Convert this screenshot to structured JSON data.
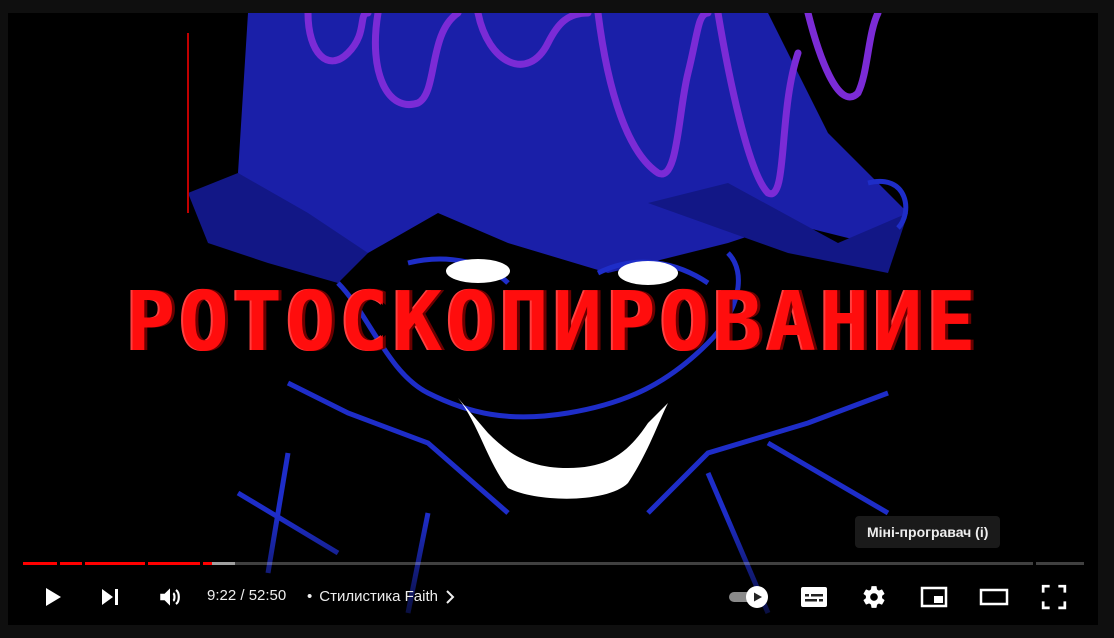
{
  "video": {
    "overlay_title": "РОТОСКОПИРОВАНИЕ"
  },
  "player": {
    "current_time": "9:22",
    "separator": " / ",
    "duration": "52:50",
    "time_display": "9:22 / 52:50",
    "chapter_bullet": "•",
    "chapter_title": "Стилистика Faith",
    "progress_played_fraction": 0.178,
    "progress_loaded_fraction": 0.2
  },
  "tooltip": {
    "text": "Міні-програвач (і)"
  },
  "controls": {
    "play_icon": "play-icon",
    "next_icon": "next-icon",
    "volume_icon": "volume-icon",
    "autoplay_icon": "autoplay-toggle-icon",
    "subtitles_icon": "subtitles-icon",
    "settings_icon": "gear-icon",
    "miniplayer_icon": "miniplayer-icon",
    "theater_icon": "theater-mode-icon",
    "fullscreen_icon": "fullscreen-icon"
  },
  "colors": {
    "accent": "#ff0000",
    "title_red": "#ff0d0d",
    "art_blue": "#1a1fa8",
    "art_purple": "#7b2bd6"
  }
}
